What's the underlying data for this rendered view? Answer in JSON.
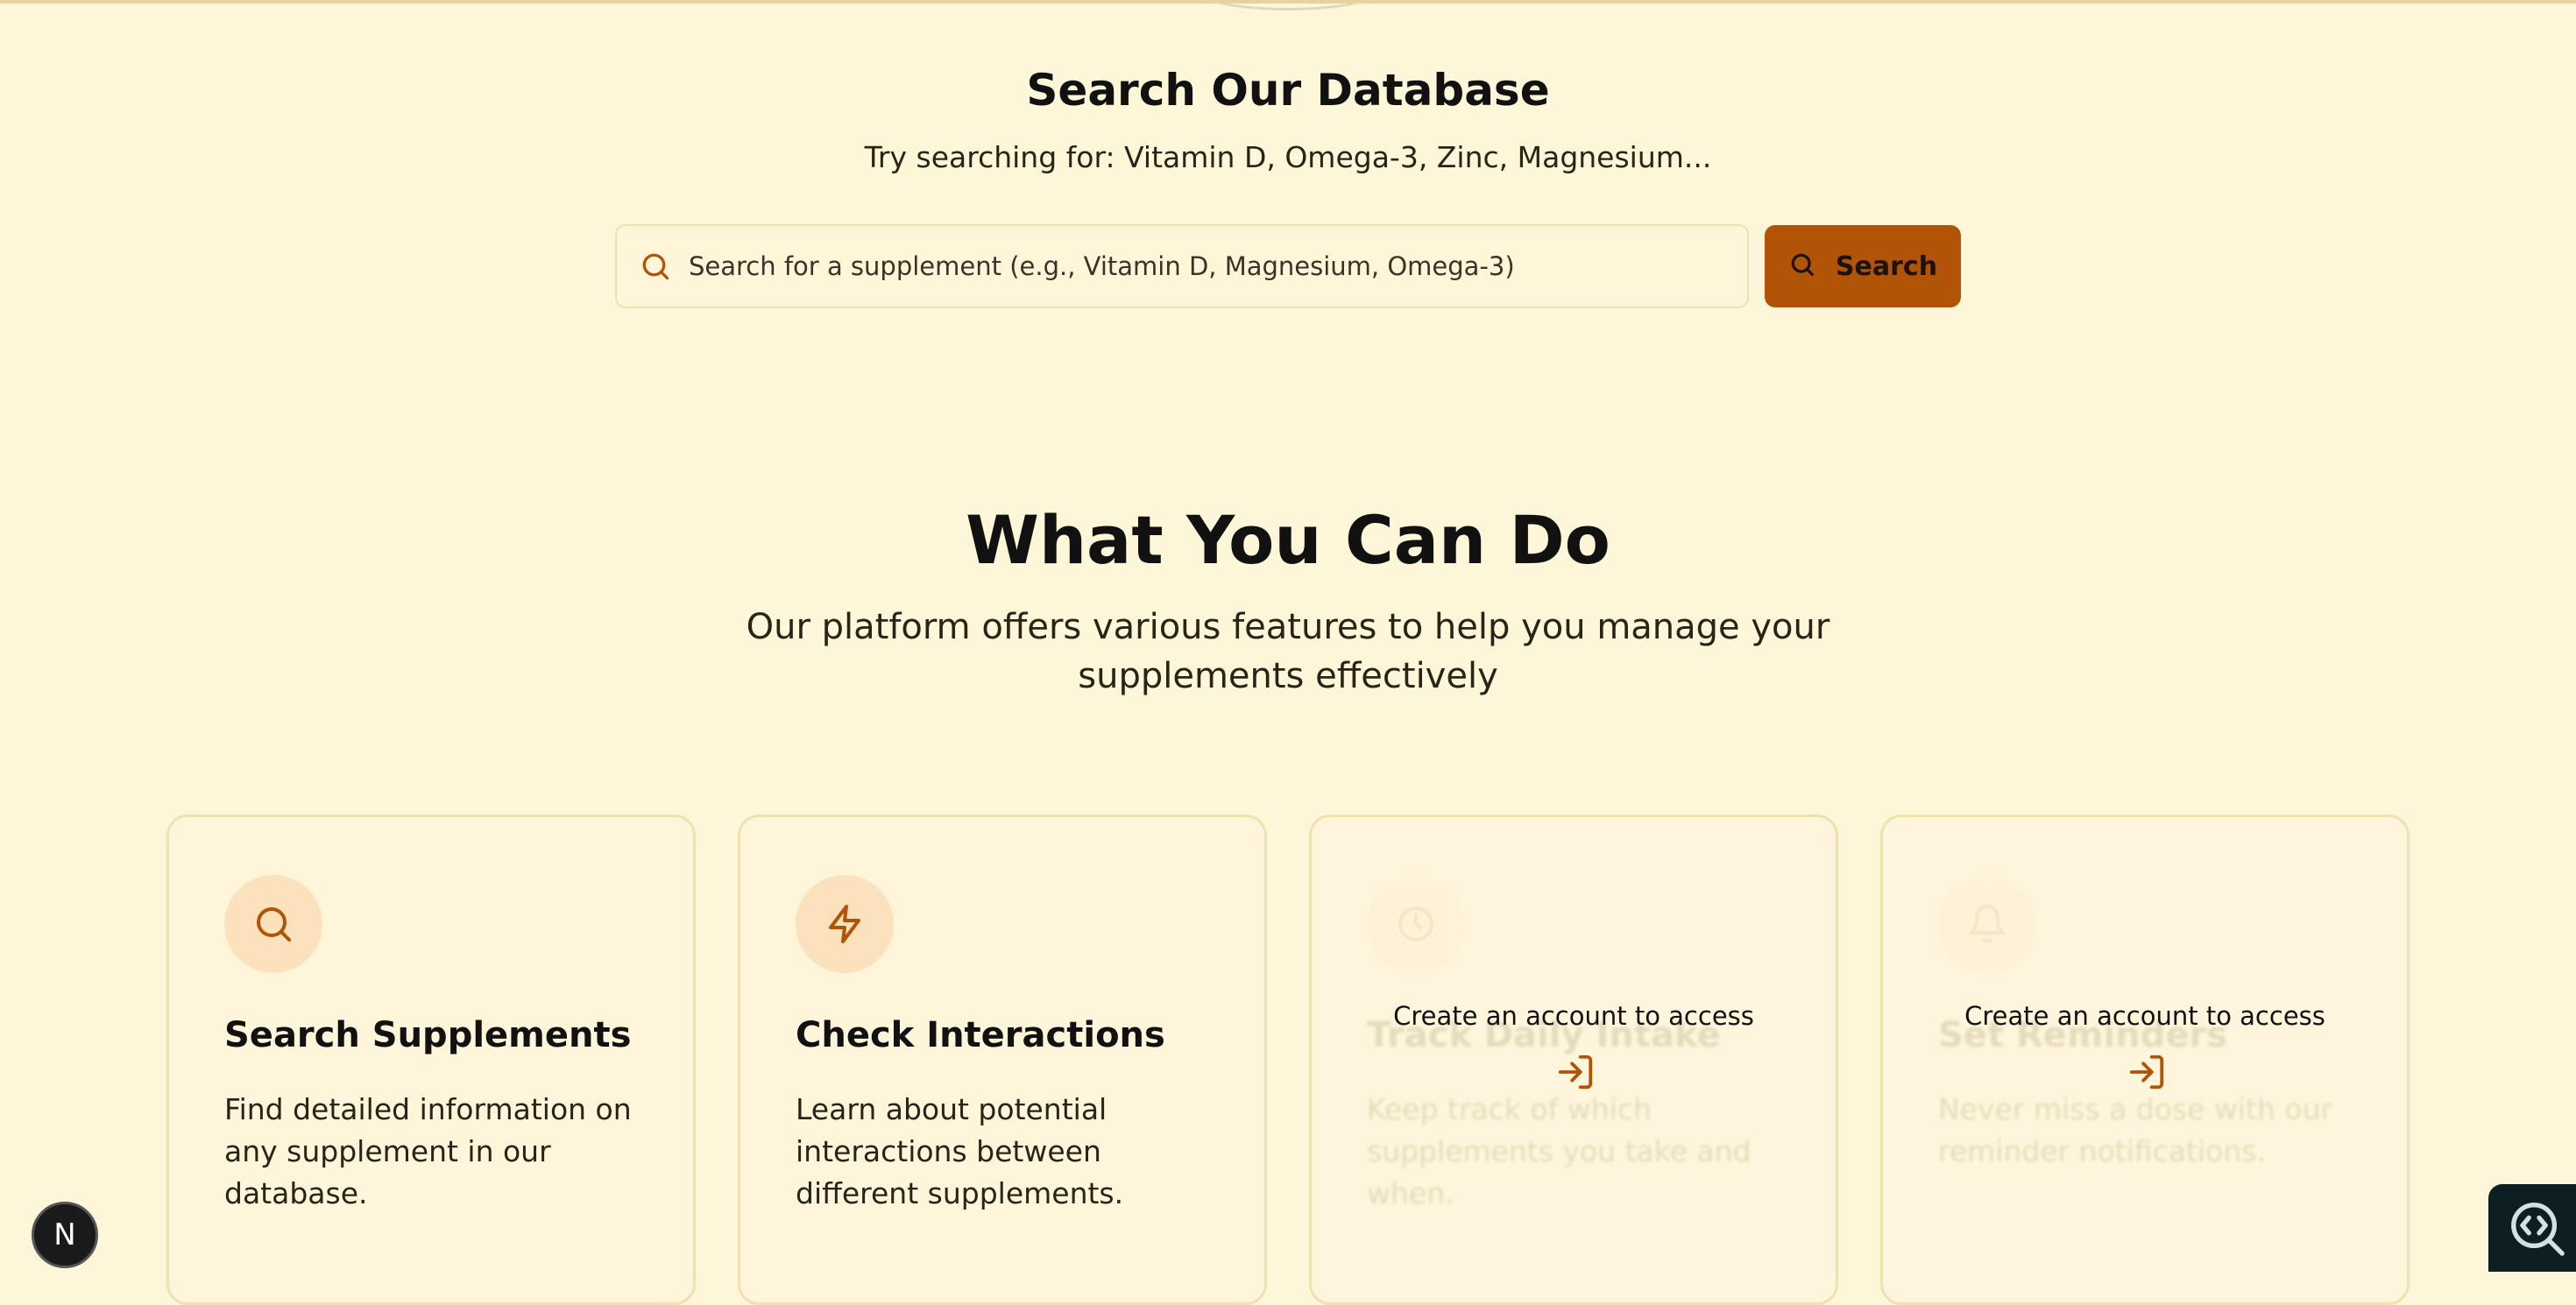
{
  "search": {
    "title": "Search Our Database",
    "subtitle": "Try searching for: Vitamin D, Omega-3, Zinc, Magnesium...",
    "placeholder": "Search for a supplement (e.g., Vitamin D, Magnesium, Omega-3)",
    "value": "",
    "button_label": "Search"
  },
  "features": {
    "title": "What You Can Do",
    "subtitle": "Our platform offers various features to help you manage your supplements effectively",
    "cards": [
      {
        "icon": "search-icon",
        "title": "Search Supplements",
        "description": "Find detailed information on any supplement in our database.",
        "locked": false
      },
      {
        "icon": "zap-icon",
        "title": "Check Interactions",
        "description": "Learn about potential interactions between different supplements.",
        "locked": false
      },
      {
        "icon": "clock-icon",
        "title": "Track Daily Intake",
        "description": "Keep track of which supplements you take and when.",
        "locked": true,
        "lock_message": "Create an account to access"
      },
      {
        "icon": "bell-icon",
        "title": "Set Reminders",
        "description": "Never miss a dose with our reminder notifications.",
        "locked": true,
        "lock_message": "Create an account to access"
      }
    ]
  },
  "badges": {
    "next_letter": "N"
  },
  "colors": {
    "background": "#fef6d8",
    "accent": "#b15408",
    "card_background": "#fff5da",
    "card_border": "#f2e0ad",
    "icon_circle": "#fbe2bc"
  }
}
